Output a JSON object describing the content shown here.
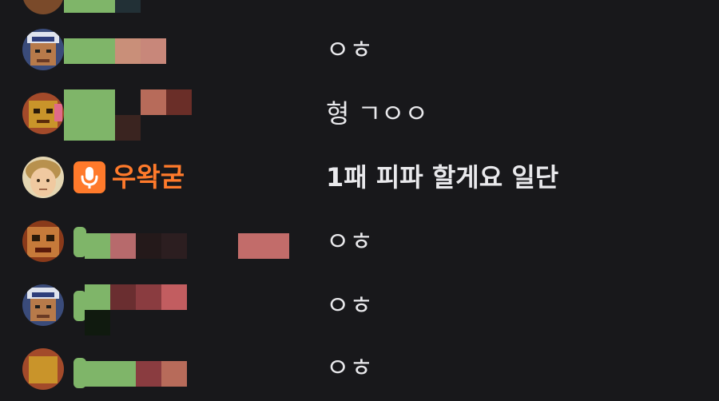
{
  "colors": {
    "background": "#18181b",
    "text": "#e9e9ec",
    "highlight_name": "#ff7a2b",
    "mic_badge": "#ff7a2b",
    "redaction_green": "#7fb569",
    "redaction_pink": "#c26c6a"
  },
  "chat": {
    "messages": [
      {
        "id": "m0",
        "user_redacted": true,
        "text": ""
      },
      {
        "id": "m1",
        "user_redacted": true,
        "text": "ㅇㅎ"
      },
      {
        "id": "m2",
        "user_redacted": true,
        "text": "형 ㄱㅇㅇ"
      },
      {
        "id": "m3",
        "user_redacted": false,
        "username": "우왁굳",
        "badge_icon": "microphone-icon",
        "text": "1패 피파 할게요 일단"
      },
      {
        "id": "m4",
        "user_redacted": true,
        "text": "ㅇㅎ"
      },
      {
        "id": "m5",
        "user_redacted": true,
        "text": "ㅇㅎ"
      },
      {
        "id": "m6",
        "user_redacted": true,
        "text": "ㅇㅎ"
      }
    ]
  }
}
